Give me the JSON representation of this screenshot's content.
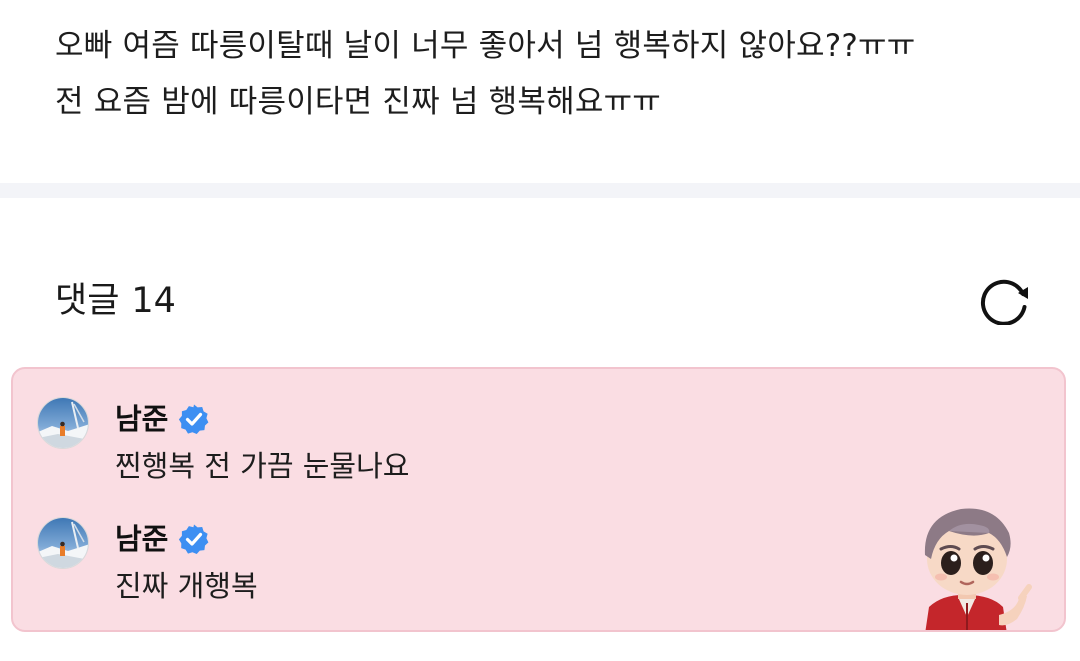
{
  "post": {
    "lines": [
      "오빠 여즘 따릉이탈때 날이 너무 좋아서 넘 행복하지 않아요??ㅠㅠ",
      "전 요즘 밤에 따릉이타면 진짜 넘 행복해요ㅠㅠ"
    ]
  },
  "comments_section": {
    "title": "댓글",
    "count": "14",
    "refresh_icon": "refresh-icon"
  },
  "comments": [
    {
      "author": "남준",
      "verified": true,
      "text": "찐행복 전 가끔 눈물나요",
      "avatar_icon": "avatar-photo"
    },
    {
      "author": "남준",
      "verified": true,
      "text": "진짜 개행복",
      "avatar_icon": "avatar-photo"
    }
  ],
  "sticker": {
    "icon": "character-sticker"
  },
  "colors": {
    "card_background": "#fadde3",
    "card_border": "#f2c4ce",
    "verified_blue": "#3d8ff2",
    "divider": "#f3f4f8"
  }
}
